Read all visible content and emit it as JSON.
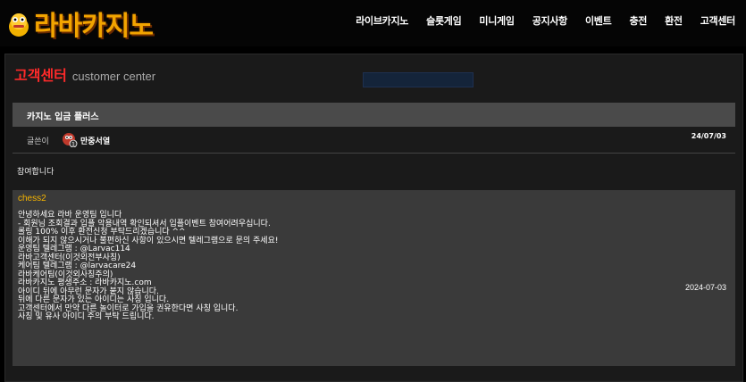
{
  "logo": {
    "text": "라바카지노"
  },
  "nav": [
    "라이브카지노",
    "슬롯게임",
    "미니게임",
    "공지사항",
    "이벤트",
    "충전",
    "환전",
    "고객센터"
  ],
  "page": {
    "title_kr": "고객센터",
    "title_en": "customer center"
  },
  "post": {
    "title": "카지노 입금 플러스",
    "author_label": "글쓴이",
    "author": "만중서열",
    "date": "24/07/03",
    "content": "참여합니다"
  },
  "reply": {
    "name": "chess2",
    "lines": [
      "안녕하세요 라바 운영팀 입니다",
      "",
      "- 회원님 조회결과 입플 악용내역 확인되셔서 입플이벤트 참여어려우십니다.",
      "롤링 100% 이후 환전신청 부탁드리겠습니다 ^^",
      "",
      "이해가 되지 않으시거나 불편하신 사항이 있으시면 텔레그램으로 문의 주세요!",
      "",
      "운영팀 텔레그램 : @Larvac114",
      "라바고객센터(이것외전부사칭)",
      "케어팀 텔레그램 : @larvacare24",
      "라바케어팀(이것외사칭주의)",
      "라바카지노 평생주소 : 라바카지노.com",
      "",
      "아이디 뒤에 아무런 문자가 붙지 않습니다.",
      "뒤에 다른 문자가 있는 아이디는 사칭 입니다.",
      "고객센터에서 만약 다른 놀이터로 가입을 권유한다면 사칭 입니다.",
      "사칭 및 유사 아이디 주의 부탁 드립니다."
    ],
    "date": "2024-07-03"
  },
  "colors": {
    "accent_red": "#ff2a2a",
    "reply_name": "#f5b400",
    "logo": "#f2a400"
  }
}
